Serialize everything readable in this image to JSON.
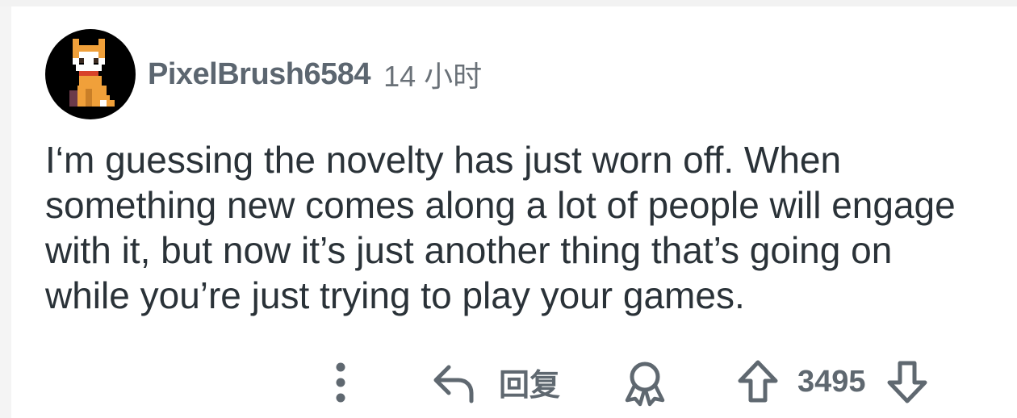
{
  "comment": {
    "author": "PixelBrush6584",
    "time": "14 小时",
    "body": "I‘m guessing the novelty has just worn off. When something new comes along a lot of people will engage with it, but now it’s just another thing that’s going on while you’re just trying to play your games.",
    "avatar_icon": "pixel-dog-avatar"
  },
  "actions": {
    "more_icon": "more-vertical-icon",
    "reply_icon": "reply-arrow-icon",
    "reply_label": "回复",
    "award_icon": "award-icon",
    "upvote_icon": "upvote-arrow-icon",
    "score": "3495",
    "downvote_icon": "downvote-arrow-icon"
  },
  "colors": {
    "text_primary": "#2a3238",
    "text_meta": "#5c6670",
    "icon": "#5f6870",
    "avatar_bg": "#000000",
    "avatar_orange": "#f0a03a"
  }
}
